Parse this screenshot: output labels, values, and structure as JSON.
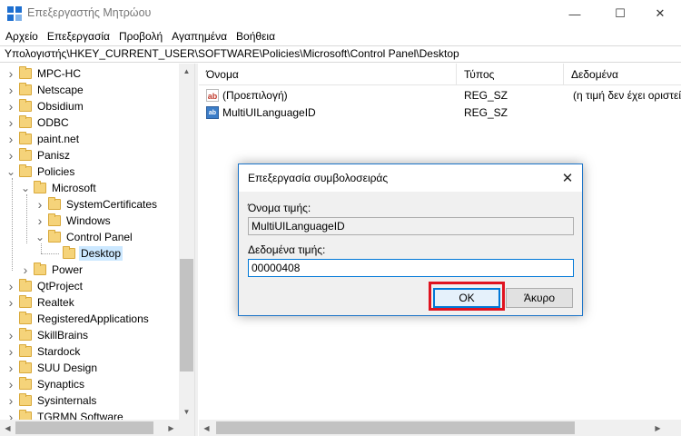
{
  "window": {
    "title": "Επεξεργαστής Μητρώου"
  },
  "menu": [
    "Αρχείο",
    "Επεξεργασία",
    "Προβολή",
    "Αγαπημένα",
    "Βοήθεια"
  ],
  "address": "Υπολογιστής\\HKEY_CURRENT_USER\\SOFTWARE\\Policies\\Microsoft\\Control Panel\\Desktop",
  "tree": [
    {
      "label": "MPC-HC",
      "level": 1,
      "chevron": "collapsed"
    },
    {
      "label": "Netscape",
      "level": 1,
      "chevron": "collapsed"
    },
    {
      "label": "Obsidium",
      "level": 1,
      "chevron": "collapsed"
    },
    {
      "label": "ODBC",
      "level": 1,
      "chevron": "collapsed"
    },
    {
      "label": "paint.net",
      "level": 1,
      "chevron": "collapsed"
    },
    {
      "label": "Panisz",
      "level": 1,
      "chevron": "collapsed"
    },
    {
      "label": "Policies",
      "level": 1,
      "chevron": "expanded"
    },
    {
      "label": "Microsoft",
      "level": 2,
      "chevron": "expanded"
    },
    {
      "label": "SystemCertificates",
      "level": 3,
      "chevron": "collapsed"
    },
    {
      "label": "Windows",
      "level": 3,
      "chevron": "collapsed"
    },
    {
      "label": "Control Panel",
      "level": 3,
      "chevron": "expanded"
    },
    {
      "label": "Desktop",
      "level": 4,
      "chevron": "none",
      "selected": true
    },
    {
      "label": "Power",
      "level": 2,
      "chevron": "collapsed"
    },
    {
      "label": "QtProject",
      "level": 1,
      "chevron": "collapsed"
    },
    {
      "label": "Realtek",
      "level": 1,
      "chevron": "collapsed"
    },
    {
      "label": "RegisteredApplications",
      "level": 1,
      "chevron": "none"
    },
    {
      "label": "SkillBrains",
      "level": 1,
      "chevron": "collapsed"
    },
    {
      "label": "Stardock",
      "level": 1,
      "chevron": "collapsed"
    },
    {
      "label": "SUU Design",
      "level": 1,
      "chevron": "collapsed"
    },
    {
      "label": "Synaptics",
      "level": 1,
      "chevron": "collapsed"
    },
    {
      "label": "Sysinternals",
      "level": 1,
      "chevron": "collapsed"
    },
    {
      "label": "TGRMN Software",
      "level": 1,
      "chevron": "collapsed"
    }
  ],
  "list": {
    "columns": [
      "Όνομα",
      "Τύπος",
      "Δεδομένα"
    ],
    "rows": [
      {
        "icon": "string-value-icon",
        "name": "(Προεπιλογή)",
        "type": "REG_SZ",
        "data": "(η τιμή δεν έχει οριστεί)"
      },
      {
        "icon": "string-value-icon",
        "name": "MultiUILanguageID",
        "type": "REG_SZ",
        "data": ""
      }
    ]
  },
  "dialog": {
    "title": "Επεξεργασία συμβολοσειράς",
    "value_name_label": "Όνομα τιμής:",
    "value_name": "MultiUILanguageID",
    "value_data_label": "Δεδομένα τιμής:",
    "value_data": "00000408",
    "ok_label": "OK",
    "cancel_label": "Άκυρο"
  },
  "icons": {
    "string_icon_text": "ab",
    "string_icon_alt_text": "ab"
  },
  "colors": {
    "accent": "#0078d7",
    "highlight": "#e0131f",
    "selection": "#cce8ff"
  }
}
